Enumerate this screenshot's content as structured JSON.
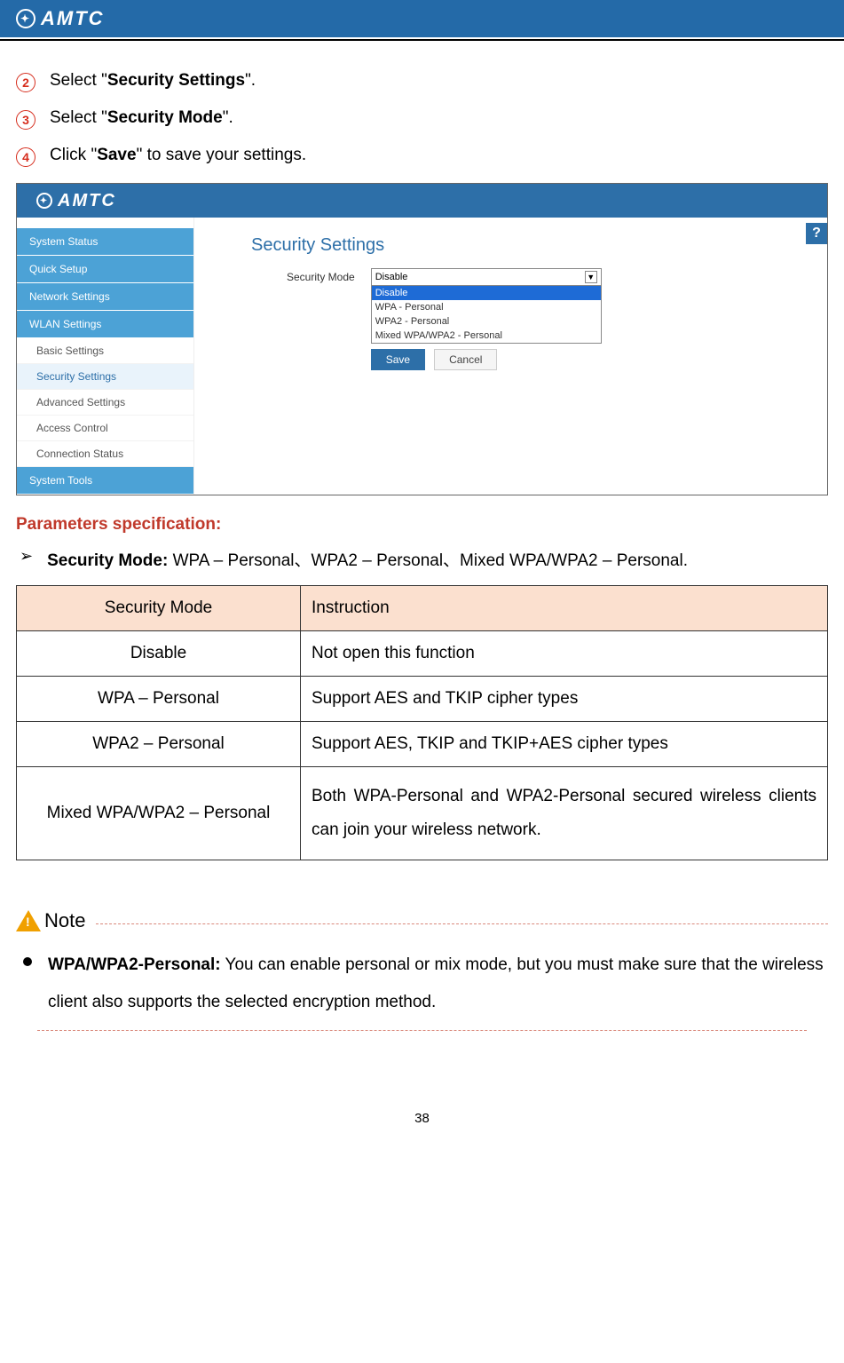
{
  "header": {
    "brand": "AMTC"
  },
  "steps": [
    {
      "num": "2",
      "pre": "Select \"",
      "bold": "Security Settings",
      "post": "\"."
    },
    {
      "num": "3",
      "pre": "Select \"",
      "bold": "Security Mode",
      "post": "\"."
    },
    {
      "num": "4",
      "pre": "Click \"",
      "bold": "Save",
      "post": "\" to save your settings."
    }
  ],
  "ui": {
    "brand": "AMTC",
    "help": "?",
    "sidebar_top": [
      "System Status",
      "Quick Setup",
      "Network Settings",
      "WLAN Settings"
    ],
    "sidebar_sub": [
      "Basic Settings",
      "Security Settings",
      "Advanced Settings",
      "Access Control",
      "Connection Status"
    ],
    "sidebar_sub_active_index": 1,
    "sidebar_bottom": [
      "System Tools"
    ],
    "panel_title": "Security Settings",
    "form_label": "Security Mode",
    "select_display": "Disable",
    "options": [
      "Disable",
      "WPA - Personal",
      "WPA2 - Personal",
      "Mixed WPA/WPA2 - Personal"
    ],
    "option_selected_index": 0,
    "buttons": {
      "save": "Save",
      "cancel": "Cancel"
    }
  },
  "params_heading": "Parameters specification:",
  "security_mode_bullet": {
    "bold": "Security Mode:",
    "rest": " WPA – Personal、WPA2 – Personal、Mixed WPA/WPA2 – Personal."
  },
  "table": {
    "headers": [
      "Security Mode",
      "Instruction"
    ],
    "rows": [
      {
        "mode": "Disable",
        "inst": "Not open this function"
      },
      {
        "mode": "WPA – Personal",
        "inst": "Support AES and TKIP cipher types"
      },
      {
        "mode": "WPA2 – Personal",
        "inst": "Support AES, TKIP and TKIP+AES cipher types"
      },
      {
        "mode": "Mixed WPA/WPA2 – Personal",
        "inst": "Both WPA-Personal and WPA2-Personal secured wireless clients can join your wireless network."
      }
    ]
  },
  "note": {
    "title": "Note",
    "bold": "WPA/WPA2-Personal:",
    "text": " You can enable personal or mix mode, but you must make sure that the wireless client also supports the selected encryption method."
  },
  "page_number": "38"
}
